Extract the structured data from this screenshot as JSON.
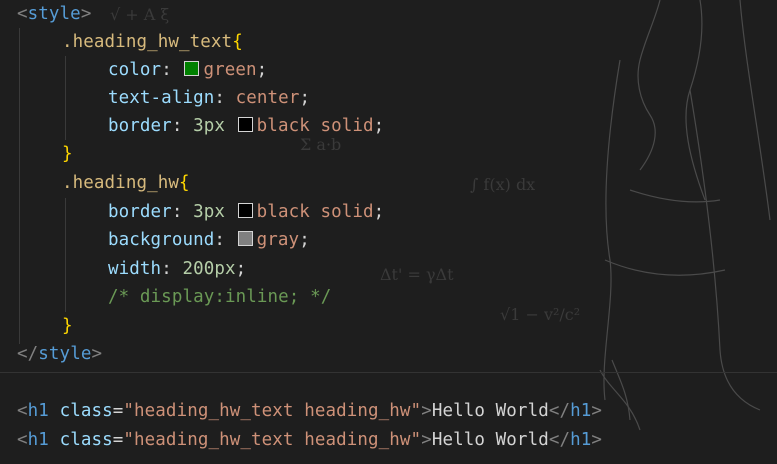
{
  "style_open": {
    "bracket_open": "<",
    "tag": "style",
    "bracket_close": ">"
  },
  "rule1": {
    "selector": ".heading_hw_text",
    "open_brace": "{",
    "decl1": {
      "prop": "color",
      "colon": ":",
      "value": "green",
      "semi": ";",
      "swatch": "#008000"
    },
    "decl2": {
      "prop": "text-align",
      "colon": ":",
      "value": "center",
      "semi": ";"
    },
    "decl3": {
      "prop": "border",
      "colon": ":",
      "num": "3px",
      "value": "black solid",
      "semi": ";",
      "swatch": "#000000"
    },
    "close_brace": "}"
  },
  "rule2": {
    "selector": ".heading_hw",
    "open_brace": "{",
    "decl1": {
      "prop": "border",
      "colon": ":",
      "num": "3px",
      "value": "black solid",
      "semi": ";",
      "swatch": "#000000"
    },
    "decl2": {
      "prop": "background",
      "colon": ":",
      "value": "gray",
      "semi": ";",
      "swatch": "#808080"
    },
    "decl3": {
      "prop": "width",
      "colon": ":",
      "num": "200px",
      "semi": ";"
    },
    "comment": "/* display:inline; */",
    "close_brace": "}"
  },
  "style_close": {
    "bracket_open": "</",
    "tag": "style",
    "bracket_close": ">"
  },
  "h1_lines": [
    {
      "lt": "<",
      "tag": "h1",
      "attr": "class",
      "eq": "=",
      "value": "\"heading_hw_text heading_hw\"",
      "gt": ">",
      "text": "Hello World",
      "close_lt": "</",
      "close_tag": "h1",
      "close_gt": ">"
    },
    {
      "lt": "<",
      "tag": "h1",
      "attr": "class",
      "eq": "=",
      "value": "\"heading_hw_text heading_hw\"",
      "gt": ">",
      "text": "Hello World",
      "close_lt": "</",
      "close_tag": "h1",
      "close_gt": ">"
    }
  ],
  "colors": {
    "background": "#1e1e1e",
    "tag": "#569cd6",
    "selector": "#d7ba7d",
    "brace": "#ffd700",
    "property": "#9cdcfe",
    "value": "#ce9178",
    "number": "#b5cea8",
    "comment": "#6a9955"
  }
}
